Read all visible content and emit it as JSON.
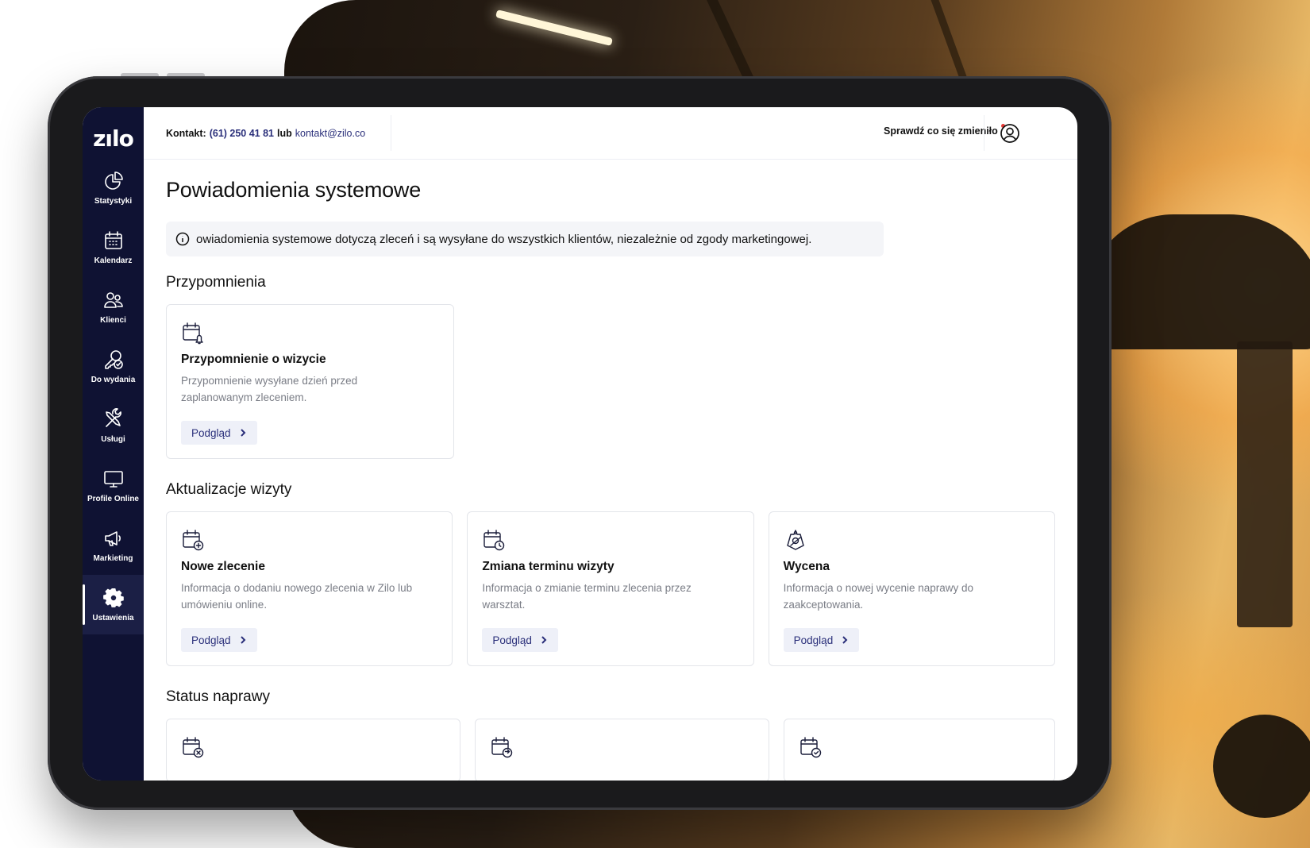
{
  "app": {
    "logo": "zılo"
  },
  "sidebar": {
    "items": [
      {
        "label": "Statystyki",
        "icon": "pie-chart-icon"
      },
      {
        "label": "Kalendarz",
        "icon": "calendar-icon"
      },
      {
        "label": "Klienci",
        "icon": "users-icon"
      },
      {
        "label": "Do wydania",
        "icon": "key-check-icon"
      },
      {
        "label": "Usługi",
        "icon": "tools-icon"
      },
      {
        "label": "Profile Online",
        "icon": "monitor-icon"
      },
      {
        "label": "Markieting",
        "icon": "megaphone-icon"
      },
      {
        "label": "Ustawienia",
        "icon": "gear-icon",
        "active": true
      }
    ]
  },
  "topbar": {
    "contact_label": "Kontakt:",
    "phone": "(61) 250 41 81",
    "or": "lub",
    "email": "kontakt@zilo.co",
    "whats_new": "Sprawdź co się zmieniło"
  },
  "page": {
    "title": "Powiadomienia systemowe",
    "info": "owiadomienia systemowe dotyczą zleceń i są wysyłane do wszystkich klientów, niezależnie od zgody marketingowej."
  },
  "sections": [
    {
      "title": "Przypomnienia",
      "cards": [
        {
          "icon": "calendar-bell-icon",
          "title": "Przypomnienie o wizycie",
          "desc": "Przypomnienie wysyłane dzień przed zaplanowanym zleceniem.",
          "button": "Podgląd"
        }
      ]
    },
    {
      "title": "Aktualizacje wizyty",
      "cards": [
        {
          "icon": "calendar-plus-icon",
          "title": "Nowe zlecenie",
          "desc": "Informacja o dodaniu nowego zlecenia w Zilo lub umówieniu online.",
          "button": "Podgląd"
        },
        {
          "icon": "calendar-clock-icon",
          "title": "Zmiana terminu wizyty",
          "desc": "Informacja o zmianie terminu zlecenia przez warsztat.",
          "button": "Podgląd"
        },
        {
          "icon": "price-tag-icon",
          "title": "Wycena",
          "desc": "Informacja o nowej wycenie naprawy do zaakceptowania.",
          "button": "Podgląd"
        }
      ]
    },
    {
      "title": "Status naprawy",
      "cards": [
        {
          "icon": "calendar-x-icon"
        },
        {
          "icon": "calendar-arrow-icon"
        },
        {
          "icon": "calendar-check-icon"
        }
      ]
    }
  ],
  "colors": {
    "sidebar": "#0f1233",
    "accent": "#2a2f7a",
    "notify_dot": "#e53935"
  }
}
